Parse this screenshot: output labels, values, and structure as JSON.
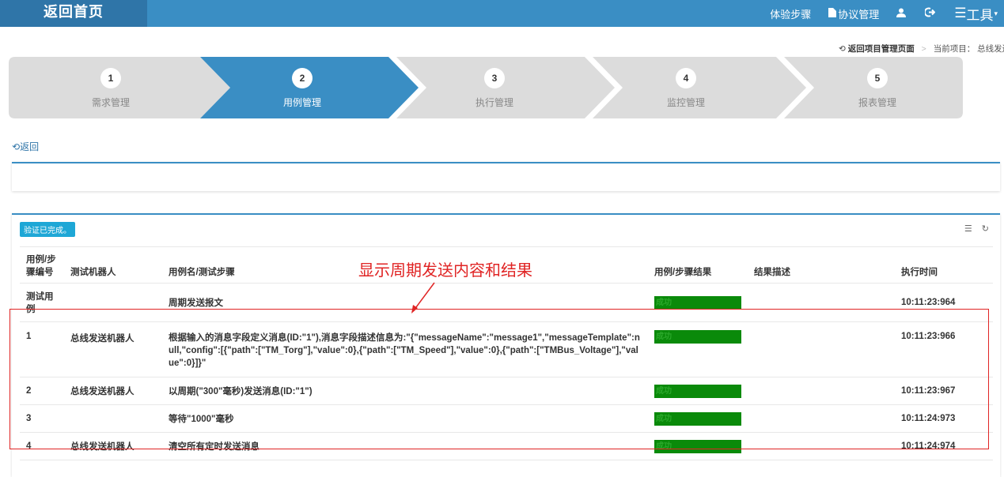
{
  "nav": {
    "home": "返回首页",
    "items": [
      {
        "label": "体验步骤",
        "icon": ""
      },
      {
        "label": "协议管理",
        "icon": "file-icon"
      },
      {
        "label": "",
        "icon": "user-icon"
      },
      {
        "label": "",
        "icon": "logout-icon"
      }
    ],
    "tools": "工具",
    "accent": "#3a8ec4",
    "home_bg": "#2f75a8"
  },
  "breadcrumb": {
    "back_project": "返回项目管理页面",
    "current_label": "当前项目：",
    "current_project": "总线发送"
  },
  "wizard": {
    "steps": [
      {
        "num": "1",
        "label": "需求管理",
        "active": false
      },
      {
        "num": "2",
        "label": "用例管理",
        "active": true
      },
      {
        "num": "3",
        "label": "执行管理",
        "active": false
      },
      {
        "num": "4",
        "label": "监控管理",
        "active": false
      },
      {
        "num": "5",
        "label": "报表管理",
        "active": false
      }
    ],
    "active_color": "#3a8ec4",
    "inactive_color": "#dcdcdc"
  },
  "back_link": "返回",
  "result_panel": {
    "badge": "验证已完成。",
    "headers": {
      "id": "用例/步骤编号",
      "robot": "测试机器人",
      "name": "用例名/测试步骤",
      "result": "用例/步骤结果",
      "desc": "结果描述",
      "time": "执行时间"
    },
    "rows": [
      {
        "id": "测试用例",
        "robot": "",
        "name": "周期发送报文",
        "status": "成功",
        "desc": "",
        "time": "10:11:23:964"
      },
      {
        "id": "1",
        "robot": "总线发送机器人",
        "name": "根据输入的消息字段定义消息(ID:\"1\"),消息字段描述信息为:\"{\"messageName\":\"message1\",\"messageTemplate\":null,\"config\":[{\"path\":[\"TM_Torg\"],\"value\":0},{\"path\":[\"TM_Speed\"],\"value\":0},{\"path\":[\"TMBus_Voltage\"],\"value\":0}]}\"",
        "status": "成功",
        "desc": "",
        "time": "10:11:23:966"
      },
      {
        "id": "2",
        "robot": "总线发送机器人",
        "name": "以周期(\"300\"毫秒)发送消息(ID:\"1\")",
        "status": "成功",
        "desc": "",
        "time": "10:11:23:967"
      },
      {
        "id": "3",
        "robot": "",
        "name": "等待\"1000\"毫秒",
        "status": "成功",
        "desc": "",
        "time": "10:11:24:973"
      },
      {
        "id": "4",
        "robot": "总线发送机器人",
        "name": "清空所有定时发送消息",
        "status": "成功",
        "desc": "",
        "time": "10:11:24:974"
      }
    ],
    "success_color": "#0a8a0a"
  },
  "annotation": {
    "text": "显示周期发送内容和结果",
    "color": "#e02424"
  }
}
